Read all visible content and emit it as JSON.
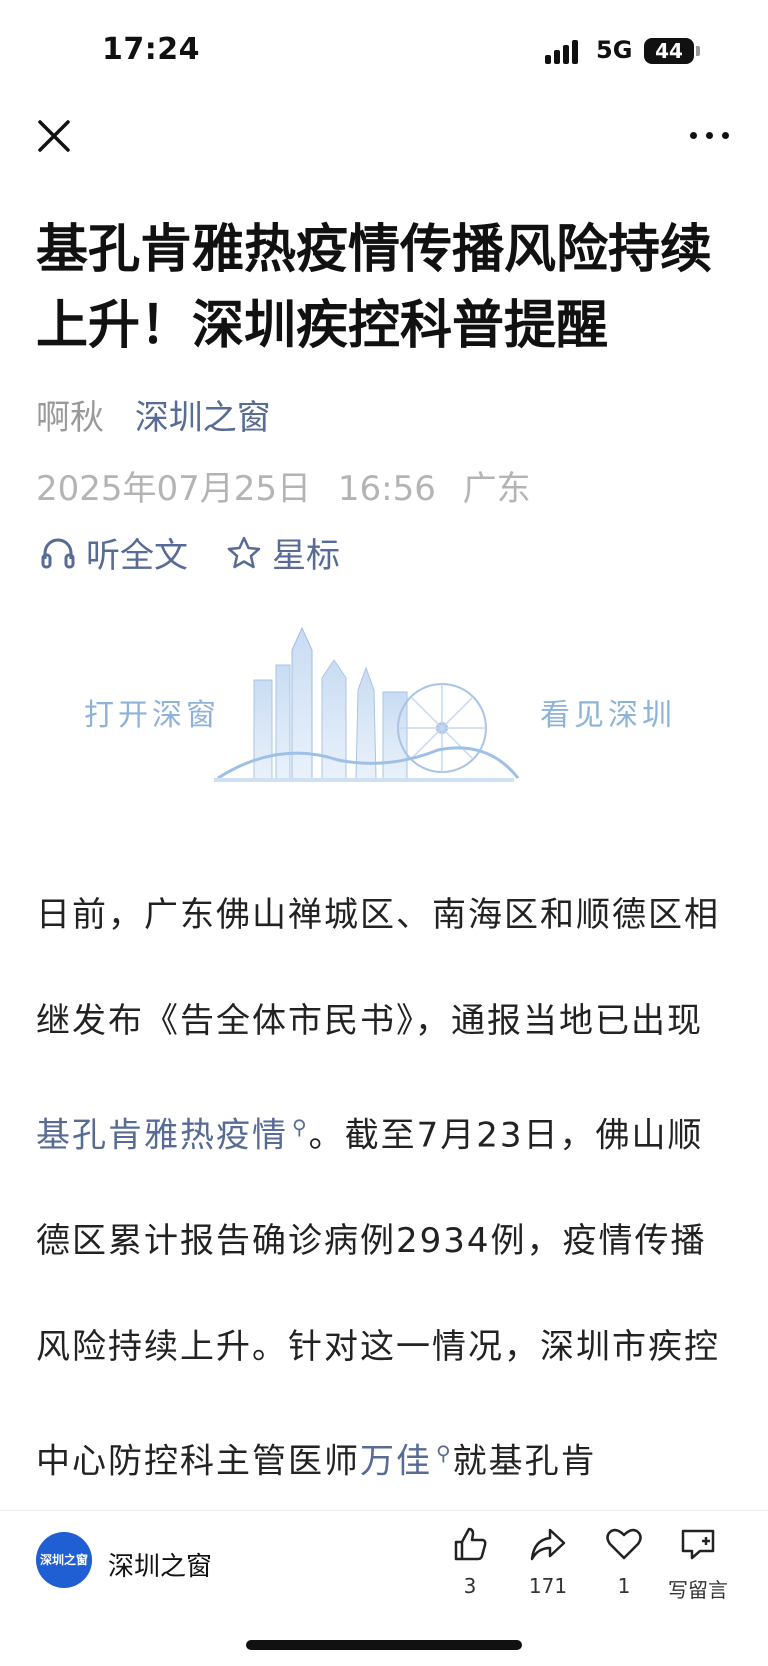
{
  "status": {
    "time": "17:24",
    "network": "5G",
    "battery": "44"
  },
  "nav": {
    "close_icon": "close-icon",
    "more_icon": "more-icon"
  },
  "article": {
    "title": "基孔肯雅热疫情传播风险持续上升！深圳疾控科普提醒",
    "author": "啊秋",
    "source": "深圳之窗",
    "date": "2025年07月25日",
    "time": "16:56",
    "location": "广东",
    "listen_label": "听全文",
    "star_label": "星标",
    "banner_left": "打开深窗",
    "banner_right": "看见深圳",
    "body": {
      "p1": "日前，广东佛山禅城区、南海区和顺德区相继发布《告全体市民书》，通报当地已出现",
      "kw1": "基孔肯雅热疫情",
      "p2": "。截至7月23日，佛山顺德区累计报告确诊病例2934例，疫情传播风险持续上升。针对这一情况，深圳市疾控中心防控科主管医师",
      "kw2": "万佳",
      "p3": "就基孔肯"
    }
  },
  "bottom": {
    "account_name": "深圳之窗",
    "account_logo_text": "深圳之窗",
    "like_count": "3",
    "share_count": "171",
    "fav_count": "1",
    "comment_label": "写留言"
  },
  "colors": {
    "link": "#576b95",
    "brand_blue": "#1f5fd3"
  }
}
